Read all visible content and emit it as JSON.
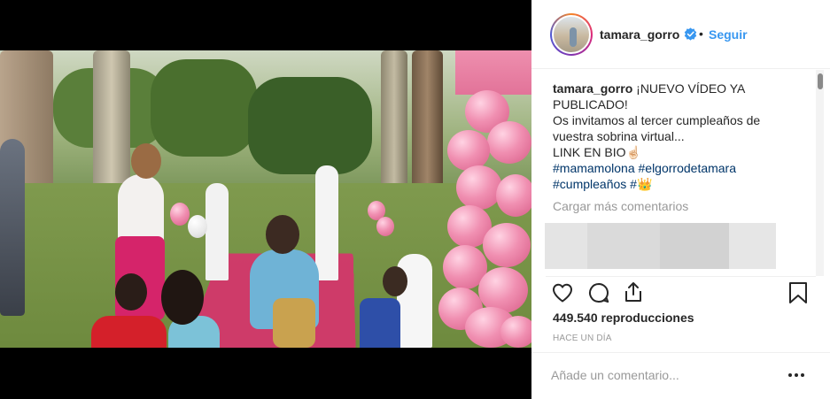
{
  "post": {
    "username": "tamara_gorro",
    "dot": "•",
    "follow_label": "Seguir",
    "verified": true,
    "caption": {
      "username": "tamara_gorro",
      "lines": [
        "¡NUEVO VÍDEO YA",
        "PUBLICADO!",
        "Os invitamos al tercer cumpleaños de",
        "vuestra sobrina virtual...",
        "LINK EN BIO☝🏻"
      ],
      "hashtags_line1": [
        "#mamamolona",
        "#elgorrodetamara"
      ],
      "hashtags_line2": [
        "#cumpleaños",
        "#👑"
      ]
    },
    "load_more_label": "Cargar más comentarios",
    "views_count": "449.540",
    "views_label": "reproducciones",
    "time_ago": "HACE UN DÍA",
    "comment_placeholder": "Añade un comentario...",
    "icons": [
      "heart-icon",
      "comment-icon",
      "share-icon",
      "bookmark-icon",
      "more-options-icon",
      "verified-badge-icon"
    ],
    "colors": {
      "link": "#3897f0",
      "hashtag": "#003569",
      "text": "#262626",
      "muted": "#999999",
      "verified": "#3897f0"
    }
  }
}
